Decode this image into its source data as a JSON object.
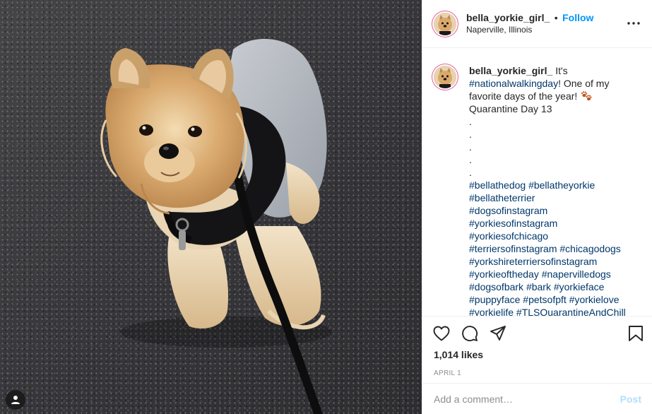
{
  "post": {
    "username": "bella_yorkie_girl_",
    "separator": "•",
    "follow_label": "Follow",
    "location": "Naperville, Illinois",
    "more_label": "•••"
  },
  "caption": {
    "username": "bella_yorkie_girl_",
    "lines": [
      [
        "It's"
      ],
      [
        "#nationalwalkingday",
        "! One of my"
      ],
      [
        "favorite days of the year!"
      ],
      [
        "Quarantine Day 13"
      ],
      [
        "."
      ],
      [
        "."
      ],
      [
        "."
      ],
      [
        "."
      ],
      [
        "."
      ]
    ],
    "hashtag_lines": [
      "#bellathedog #bellatheyorkie",
      "#bellatheterrier",
      "#dogsofinstagram",
      "#yorkiesofinstagram",
      "#yorkiesofchicago",
      "#terriersofinstagram #chicagodogs",
      "#yorkshireterriersofinstagram",
      "#yorkieoftheday #napervilledogs",
      "#dogsofbark #bark #yorkieface",
      "#puppyface #petsofpft #yorkielove",
      "#yorkielife #TLSQuarantineAndChill"
    ],
    "emoji": "paw-prints-icon"
  },
  "stats": {
    "likes": "1,014 likes",
    "date": "APRIL 1"
  },
  "comment": {
    "placeholder": "Add a comment…",
    "post_label": "Post"
  },
  "icons": [
    "heart-icon",
    "comment-icon",
    "share-icon",
    "bookmark-icon",
    "user-tag-icon",
    "more-options-icon"
  ],
  "colors": {
    "link_blue": "#0095f6",
    "hashtag": "#00376b",
    "post_disabled": "#b2dffc",
    "muted": "#8e8e8e"
  }
}
